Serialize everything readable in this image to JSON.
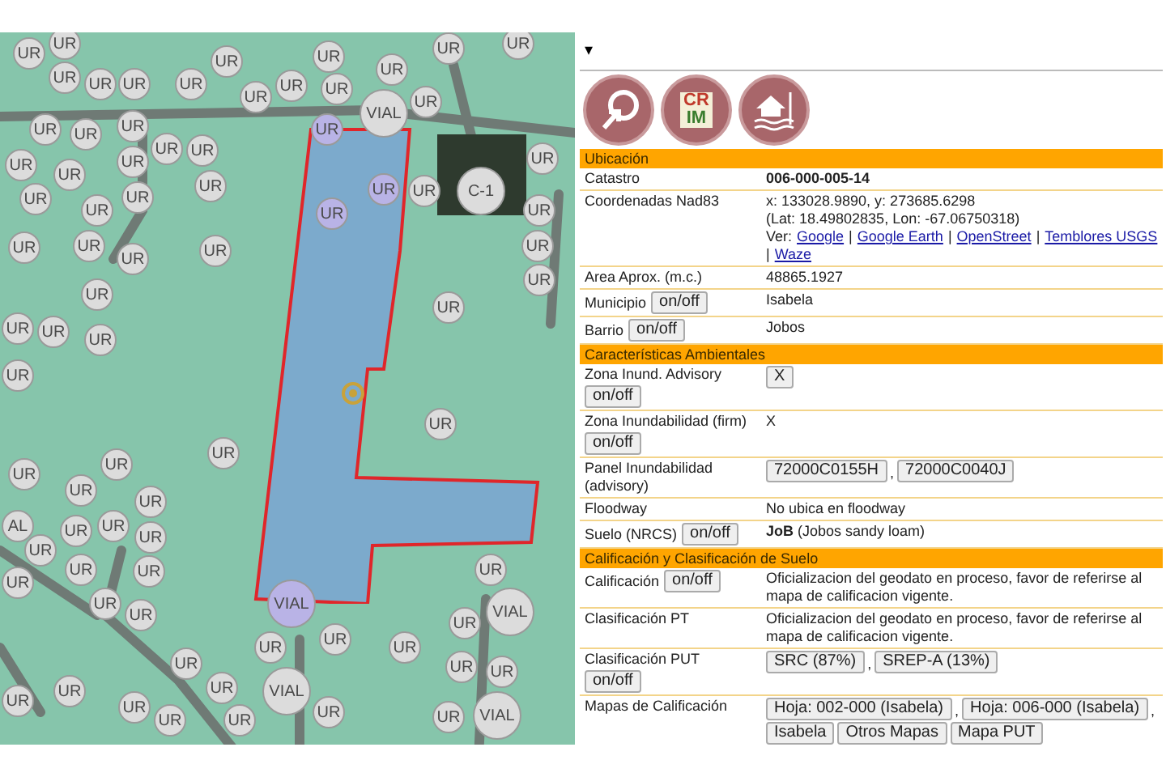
{
  "map": {
    "labels": [
      {
        "text": "UR",
        "highlighted": false
      },
      {
        "text": "UR",
        "highlighted": false
      },
      {
        "text": "UR",
        "highlighted": false
      },
      {
        "text": "UR",
        "highlighted": false
      },
      {
        "text": "UR",
        "highlighted": false
      },
      {
        "text": "UR",
        "highlighted": false
      },
      {
        "text": "UR",
        "highlighted": false
      },
      {
        "text": "UR",
        "highlighted": false
      },
      {
        "text": "UR",
        "highlighted": false
      },
      {
        "text": "UR",
        "highlighted": false
      },
      {
        "text": "UR",
        "highlighted": false
      },
      {
        "text": "UR",
        "highlighted": false
      },
      {
        "text": "UR",
        "highlighted": false
      },
      {
        "text": "UR",
        "highlighted": false
      },
      {
        "text": "UR",
        "highlighted": false
      },
      {
        "text": "UR",
        "highlighted": false
      },
      {
        "text": "UR",
        "highlighted": false
      },
      {
        "text": "UR",
        "highlighted": true
      },
      {
        "text": "VIAL",
        "highlighted": false
      },
      {
        "text": "UR",
        "highlighted": false
      },
      {
        "text": "UR",
        "highlighted": false
      },
      {
        "text": "UR",
        "highlighted": false
      },
      {
        "text": "UR",
        "highlighted": false
      },
      {
        "text": "UR",
        "highlighted": false
      },
      {
        "text": "UR",
        "highlighted": false
      },
      {
        "text": "UR",
        "highlighted": false
      },
      {
        "text": "UR",
        "highlighted": false
      },
      {
        "text": "UR",
        "highlighted": false
      },
      {
        "text": "UR",
        "highlighted": false
      },
      {
        "text": "UR",
        "highlighted": false
      },
      {
        "text": "UR",
        "highlighted": true
      },
      {
        "text": "UR",
        "highlighted": true
      },
      {
        "text": "UR",
        "highlighted": false
      },
      {
        "text": "C-1",
        "highlighted": false
      },
      {
        "text": "UR",
        "highlighted": false
      },
      {
        "text": "UR",
        "highlighted": false
      },
      {
        "text": "UR",
        "highlighted": false
      },
      {
        "text": "UR",
        "highlighted": false
      },
      {
        "text": "UR",
        "highlighted": false
      },
      {
        "text": "UR",
        "highlighted": false
      },
      {
        "text": "UR",
        "highlighted": false
      },
      {
        "text": "UR",
        "highlighted": false
      },
      {
        "text": "UR",
        "highlighted": false
      },
      {
        "text": "UR",
        "highlighted": false
      },
      {
        "text": "UR",
        "highlighted": false
      },
      {
        "text": "UR",
        "highlighted": false
      },
      {
        "text": "UR",
        "highlighted": false
      },
      {
        "text": "UR",
        "highlighted": false
      },
      {
        "text": "UR",
        "highlighted": false
      },
      {
        "text": "UR",
        "highlighted": false
      },
      {
        "text": "UR",
        "highlighted": false
      },
      {
        "text": "UR",
        "highlighted": false
      },
      {
        "text": "UR",
        "highlighted": false
      },
      {
        "text": "AL",
        "highlighted": false
      },
      {
        "text": "UR",
        "highlighted": false
      },
      {
        "text": "UR",
        "highlighted": false
      },
      {
        "text": "UR",
        "highlighted": false
      },
      {
        "text": "UR",
        "highlighted": false
      },
      {
        "text": "UR",
        "highlighted": false
      },
      {
        "text": "UR",
        "highlighted": false
      },
      {
        "text": "UR",
        "highlighted": false
      },
      {
        "text": "UR",
        "highlighted": false
      },
      {
        "text": "UR",
        "highlighted": false
      },
      {
        "text": "UR",
        "highlighted": false
      },
      {
        "text": "VIAL",
        "highlighted": true
      },
      {
        "text": "UR",
        "highlighted": false
      },
      {
        "text": "VIAL",
        "highlighted": false
      },
      {
        "text": "UR",
        "highlighted": false
      },
      {
        "text": "UR",
        "highlighted": false
      },
      {
        "text": "UR",
        "highlighted": false
      },
      {
        "text": "UR",
        "highlighted": false
      },
      {
        "text": "UR",
        "highlighted": false
      },
      {
        "text": "UR",
        "highlighted": false
      },
      {
        "text": "UR",
        "highlighted": false
      },
      {
        "text": "UR",
        "highlighted": false
      },
      {
        "text": "UR",
        "highlighted": false
      },
      {
        "text": "UR",
        "highlighted": false
      },
      {
        "text": "UR",
        "highlighted": false
      },
      {
        "text": "UR",
        "highlighted": false
      },
      {
        "text": "VIAL",
        "highlighted": false
      },
      {
        "text": "UR",
        "highlighted": false
      },
      {
        "text": "UR",
        "highlighted": false
      },
      {
        "text": "VIAL",
        "highlighted": false
      }
    ]
  },
  "panel": {
    "dropdown": "▾",
    "tools": [
      {
        "kind": "share"
      },
      {
        "kind": "logo",
        "lines": [
          "CR",
          "IM"
        ]
      },
      {
        "kind": "flood"
      }
    ],
    "sections": [
      {
        "title": "Ubicación",
        "rows": [
          {
            "label": "Catastro",
            "kind": "strong",
            "value": "006-000-005-14"
          },
          {
            "label": "Coordenadas Nad83",
            "kind": "coords",
            "lines": [
              "x: 133028.9890, y: 273685.6298",
              "(Lat: 18.49802835, Lon: -67.06750318)"
            ],
            "prefix": "Ver:",
            "links": [
              {
                "text": "Google",
                "after": "|"
              },
              {
                "text": "Google Earth",
                "after": "|"
              },
              {
                "text": "OpenStreet",
                "after": "|"
              },
              {
                "text": "Temblores USGS",
                "after": "|"
              },
              {
                "text": "Waze"
              }
            ]
          },
          {
            "label": "Area Aprox. (m.c.)",
            "kind": "text",
            "value": "48865.1927"
          },
          {
            "label": "Municipio",
            "toggle": "on/off",
            "kind": "text",
            "value": "Isabela"
          },
          {
            "label": "Barrio",
            "toggle": "on/off",
            "kind": "text",
            "value": "Jobos"
          }
        ]
      },
      {
        "title": "Características Ambientales",
        "rows": [
          {
            "label": "Zona Inund. Advisory",
            "toggle": "on/off",
            "kind": "buttons",
            "buttons": [
              {
                "text": "X"
              }
            ]
          },
          {
            "label": "Zona Inundabilidad (firm)",
            "toggle": "on/off",
            "kind": "text",
            "value": "X"
          },
          {
            "label": "Panel Inundabilidad (advisory)",
            "kind": "buttons",
            "buttons": [
              {
                "text": "72000C0155H",
                "after": ","
              },
              {
                "text": "72000C0040J"
              }
            ]
          },
          {
            "label": "Floodway",
            "kind": "text",
            "value": "No ubica en floodway"
          },
          {
            "label": "Suelo (NRCS)",
            "toggle": "on/off",
            "kind": "text",
            "value": "**JoB** (Jobos sandy loam)"
          }
        ]
      },
      {
        "title": "Calificación y Clasificación de Suelo",
        "rows": [
          {
            "label": "Calificación",
            "toggle": "on/off",
            "kind": "text",
            "value": "Oficializacion del geodato en proceso, favor de referirse al mapa de calificacion vigente."
          },
          {
            "label": "Clasificación PT",
            "kind": "text",
            "value": "Oficializacion del geodato en proceso, favor de referirse al mapa de calificacion vigente."
          },
          {
            "label": "Clasificación PUT",
            "toggle": "on/off",
            "kind": "buttons",
            "buttons": [
              {
                "text": "SRC (87%)",
                "after": ","
              },
              {
                "text": "SREP-A (13%)"
              }
            ]
          },
          {
            "label": "Mapas de Calificación",
            "kind": "buttons",
            "buttons": [
              {
                "text": "Hoja: 002-000 (Isabela)",
                "after": ","
              },
              {
                "text": "Hoja: 006-000 (Isabela)",
                "after": ","
              },
              {
                "text": "Isabela"
              },
              {
                "text": "Otros Mapas"
              },
              {
                "text": "Mapa PUT"
              }
            ]
          }
        ]
      }
    ]
  }
}
